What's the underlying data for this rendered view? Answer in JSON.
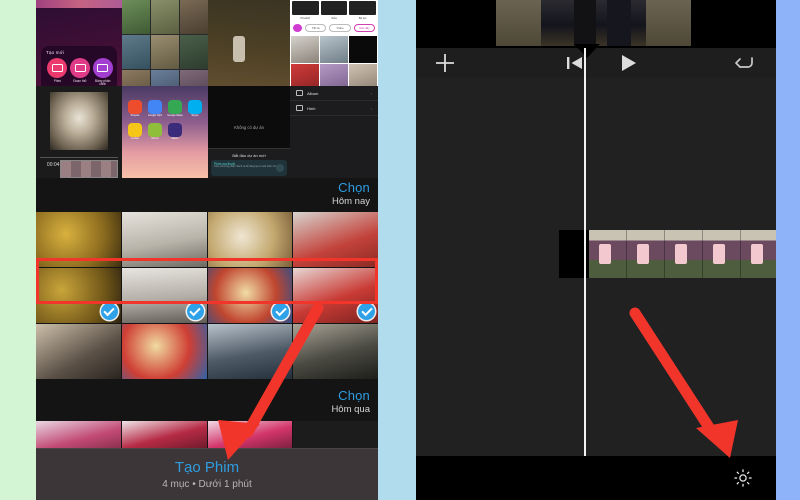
{
  "meta": {
    "description": "Two-panel Vietnamese tutorial screenshot: iOS Photos app (left) with 4 selected media items and Create Movie banner, and iMovie timeline editor (right) with settings gear highlighted.",
    "bg_left": "#d4f5d4",
    "bg_mid": "#b0dced",
    "bg_right": "#8fb3f9",
    "accent_blue": "#2e9de0",
    "annotation_red": "#f2352b"
  },
  "left_panel": {
    "app": "Photos",
    "imovie_overlay": {
      "create_title": "Tạo mới",
      "options": [
        {
          "label": "Phim",
          "icon": "movie-icon"
        },
        {
          "label": "Đoạn thử",
          "icon": "trailer-icon"
        },
        {
          "label": "Bảng phân cảnh",
          "icon": "storyboard-icon"
        }
      ],
      "project_empty_text": "Không có dự án",
      "new_project_label": "Bắt đầu dự án mới",
      "magic_card": {
        "title": "Phím ma thuật",
        "body": "Chọn phương pháp nhanh và dễ dàng tạo ra một phim cho bạn.",
        "icon": "magic-wand-icon"
      },
      "menu_items": [
        {
          "label": "Album",
          "icon": "album-icon",
          "chevron": "›"
        },
        {
          "label": "Hình",
          "icon": "photo-icon",
          "chevron": "›"
        }
      ],
      "app_icons": [
        {
          "label": "Shopee",
          "color": "#ee4d2d"
        },
        {
          "label": "Google Dịch",
          "color": "#4285f4"
        },
        {
          "label": "Google Maps",
          "color": "#34a853"
        },
        {
          "label": "Skype",
          "color": "#00aff0"
        },
        {
          "label": "Locket",
          "color": "#f5c518"
        },
        {
          "label": "Momo",
          "color": "#8fbf3a"
        },
        {
          "label": "Macro",
          "color": "#3a2c7a"
        }
      ]
    },
    "sections": [
      {
        "select_label": "Chọn",
        "date_label": "Hôm nay"
      },
      {
        "select_label": "Chọn",
        "date_label": "Hôm qua"
      }
    ],
    "selection": {
      "selected_count": 4,
      "checkmark_icon": "check-circle-icon",
      "highlight_color": "#f2352b"
    },
    "create_movie_bar": {
      "title": "Tạo Phim",
      "subtitle": "4 mục • Dưới 1 phút"
    }
  },
  "right_panel": {
    "app": "iMovie",
    "toolbar": [
      {
        "name": "add-media-button",
        "icon": "plus-icon",
        "label": "+"
      },
      {
        "name": "skip-to-start-button",
        "icon": "skip-start-icon",
        "label": "|◀"
      },
      {
        "name": "play-button",
        "icon": "play-icon",
        "label": "▶"
      },
      {
        "name": "undo-button",
        "icon": "undo-icon",
        "label": "↺"
      }
    ],
    "timeline": {
      "playhead_icon": "playhead-marker-icon",
      "clip_frames": 5
    },
    "bottom_bar": {
      "settings_icon": "gear-icon"
    }
  },
  "annotations": [
    {
      "type": "rectangle",
      "target": "selected-photo-row",
      "color": "#f2352b"
    },
    {
      "type": "arrow",
      "target": "create-movie-bar",
      "color": "#f2352b"
    },
    {
      "type": "arrow",
      "target": "settings-gear",
      "color": "#f2352b"
    }
  ]
}
